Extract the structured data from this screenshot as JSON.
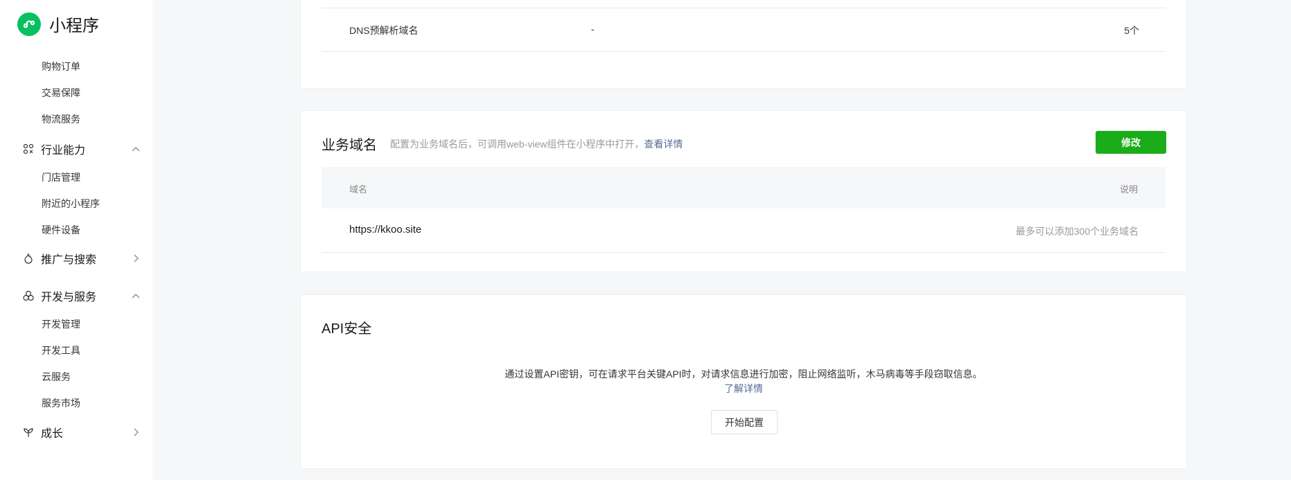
{
  "sidebar": {
    "brand_title": "小程序",
    "items": [
      {
        "type": "sub",
        "label": "购物订单"
      },
      {
        "type": "sub",
        "label": "交易保障"
      },
      {
        "type": "sub",
        "label": "物流服务"
      },
      {
        "type": "group",
        "label": "行业能力",
        "icon": "industry-icon",
        "chevron": "up"
      },
      {
        "type": "sub",
        "label": "门店管理"
      },
      {
        "type": "sub",
        "label": "附近的小程序"
      },
      {
        "type": "sub",
        "label": "硬件设备"
      },
      {
        "type": "group",
        "label": "推广与搜索",
        "icon": "flame-icon",
        "chevron": "right"
      },
      {
        "type": "group",
        "label": "开发与服务",
        "icon": "dev-service-icon",
        "chevron": "up"
      },
      {
        "type": "sub",
        "label": "开发管理"
      },
      {
        "type": "sub",
        "label": "开发工具"
      },
      {
        "type": "sub",
        "label": "云服务"
      },
      {
        "type": "sub",
        "label": "服务市场"
      },
      {
        "type": "group",
        "label": "成长",
        "icon": "growth-icon",
        "chevron": "right"
      }
    ]
  },
  "dns_row": {
    "name": "DNS预解析域名",
    "value": "-",
    "count": "5个"
  },
  "business_domain": {
    "title": "业务域名",
    "desc": "配置为业务域名后，可调用web-view组件在小程序中打开，",
    "desc_link": "查看详情",
    "edit_button": "修改",
    "columns": {
      "domain": "域名",
      "note": "说明"
    },
    "rows": [
      {
        "domain": "https://kkoo.site",
        "note": "最多可以添加300个业务域名"
      }
    ]
  },
  "api_security": {
    "title": "API安全",
    "desc": "通过设置API密钥，可在请求平台关键API时，对请求信息进行加密，阻止网络监听，木马病毒等手段窃取信息。",
    "link": "了解详情",
    "button": "开始配置"
  },
  "colors": {
    "brand_green": "#07c160",
    "primary_button": "#1aad19",
    "link": "#576b95"
  }
}
